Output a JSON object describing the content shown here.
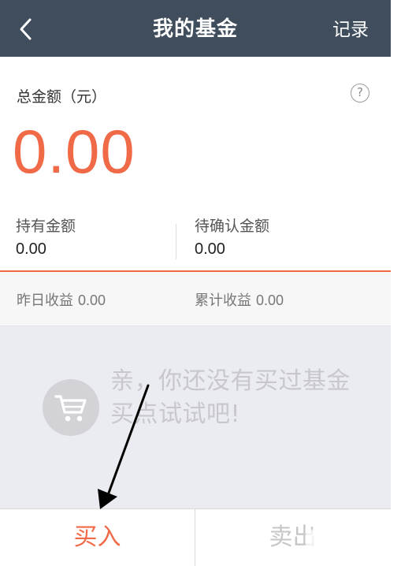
{
  "header": {
    "title": "我的基金",
    "record_label": "记录",
    "back_icon": "chevron-left-icon"
  },
  "summary": {
    "total_label": "总金额（元）",
    "total_value": "0.00",
    "help_label": "?",
    "holding_label": "持有金额",
    "holding_value": "0.00",
    "pending_label": "待确认金额",
    "pending_value": "0.00"
  },
  "yield": {
    "yesterday_label": "昨日收益",
    "yesterday_value": "0.00",
    "cumulative_label": "累计收益",
    "cumulative_value": "0.00"
  },
  "empty_state": {
    "message_line_1": "亲，你还没有买过基金",
    "message_line_2": "买点试试吧!",
    "icon": "shopping-cart-icon"
  },
  "actions": {
    "buy_label": "买入",
    "sell_label": "卖出"
  },
  "colors": {
    "header": "#3f4d5d",
    "accent": "#f06a48",
    "empty_panel": "#ebebf2",
    "muted_text": "#c7c7cd"
  },
  "annotations": {
    "arrow": "black-arrow-pointing-to-buy-button"
  }
}
